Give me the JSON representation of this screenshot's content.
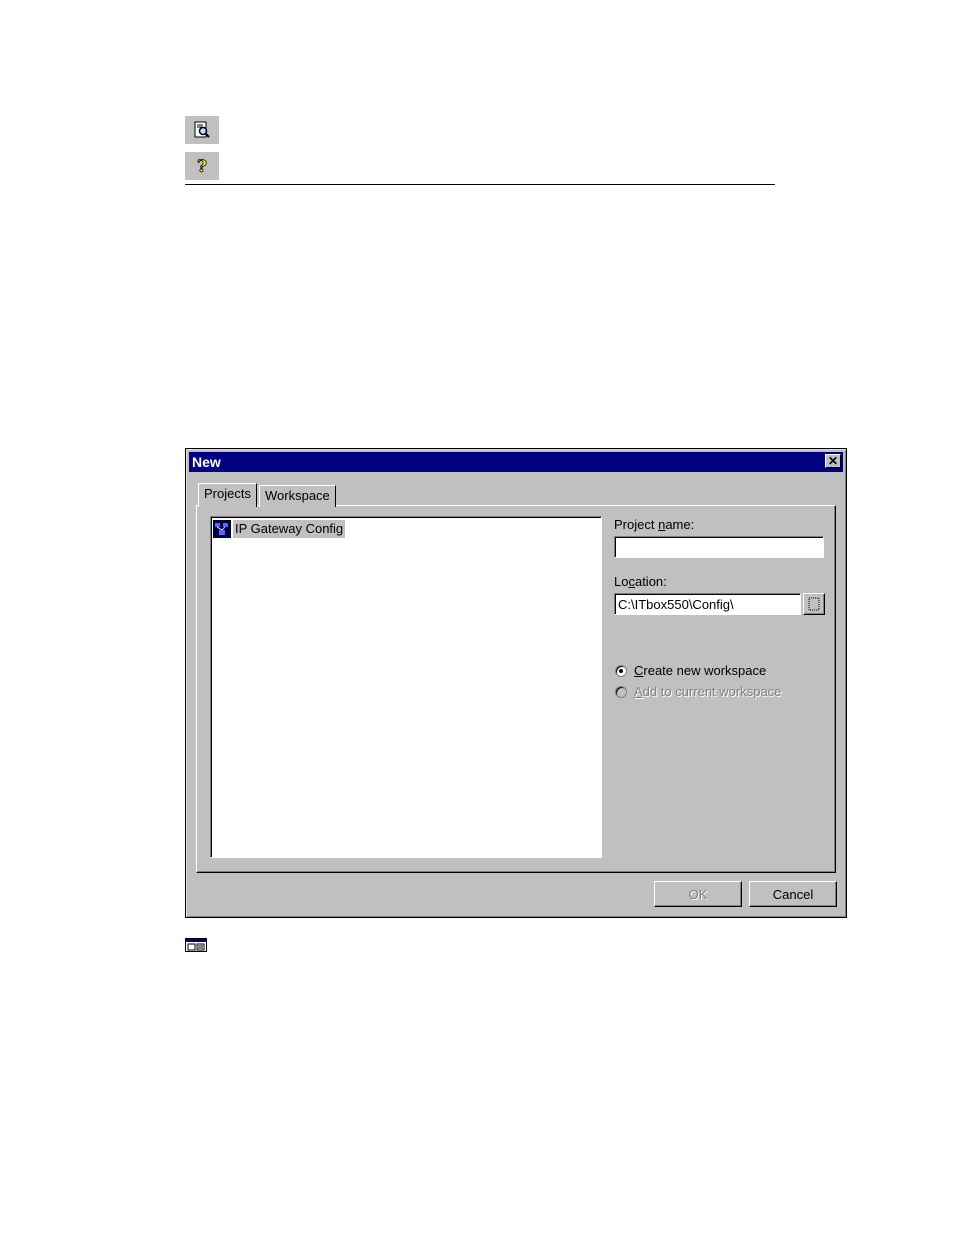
{
  "page_icons": [
    {
      "name": "print-preview-icon"
    },
    {
      "name": "help-icon"
    }
  ],
  "dialog": {
    "title": "New",
    "close_glyph": "✕",
    "tabs": [
      "Projects",
      "Workspace"
    ],
    "project_types": [
      {
        "label": "IP Gateway Config",
        "icon": "gateway-config-icon"
      }
    ],
    "project_name": {
      "label_pre": "Project ",
      "label_mnemonic": "n",
      "label_post": "ame:",
      "value": ""
    },
    "location": {
      "label_pre": "Lo",
      "label_mnemonic": "c",
      "label_post": "ation:",
      "value": "C:\\ITbox550\\Config\\"
    },
    "workspace_options": [
      {
        "mnemonic": "C",
        "rest": "reate new workspace",
        "selected": true,
        "enabled": true
      },
      {
        "mnemonic": "A",
        "rest": "dd to current workspace",
        "selected": false,
        "enabled": false
      }
    ],
    "buttons": {
      "ok": "OK",
      "cancel": "Cancel"
    }
  },
  "footer_icon": "window-tile-icon"
}
